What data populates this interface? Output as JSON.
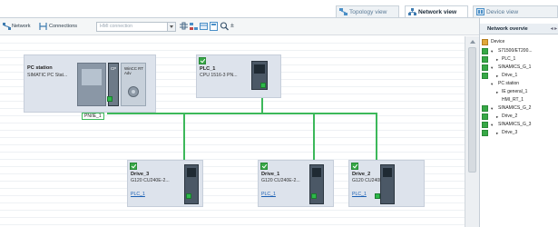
{
  "view_tabs": [
    {
      "label": "Topology view",
      "icon": "topology-icon",
      "active": false
    },
    {
      "label": "Network view",
      "icon": "network-icon",
      "active": true
    },
    {
      "label": "Device view",
      "icon": "device-icon",
      "active": false
    }
  ],
  "toolbar": {
    "network_label": "Network",
    "connections_label": "Connections",
    "connection_type_placeholder": "HMI connection"
  },
  "devices": {
    "pc_station": {
      "name": "PC station",
      "type": "SIMATIC PC Stat...",
      "module_labels": [
        "CP",
        "WinCC RT Adv"
      ]
    },
    "plc_1": {
      "name": "PLC_1",
      "type": "CPU 1516-3 PN..."
    },
    "drive_3": {
      "name": "Drive_3",
      "type": "G120 CU240E-2...",
      "link": "PLC_1"
    },
    "drive_1": {
      "name": "Drive_1",
      "type": "G120 CU240E-2...",
      "link": "PLC_1"
    },
    "drive_2": {
      "name": "Drive_2",
      "type": "G120 CU240E-2...",
      "link": "PLC_1"
    }
  },
  "port_label": "PN/IE_1",
  "network_overview": {
    "title": "Network overvie",
    "nav": "◂ ▸",
    "tree": [
      {
        "label": "Device",
        "level": 0,
        "icon": "device-icon"
      },
      {
        "label": "S71500/ET200...",
        "level": 1
      },
      {
        "label": "PLC_1",
        "level": 2
      },
      {
        "label": "SINAMICS_G_1",
        "level": 1
      },
      {
        "label": "Drive_1",
        "level": 2
      },
      {
        "label": "PC station",
        "level": 1
      },
      {
        "label": "IE general_1",
        "level": 2
      },
      {
        "label": "HMI_RT_1",
        "level": 2
      },
      {
        "label": "SINAMICS_G_2",
        "level": 1
      },
      {
        "label": "Drive_2",
        "level": 2
      },
      {
        "label": "SINAMICS_G_3",
        "level": 1
      },
      {
        "label": "Drive_3",
        "level": 2
      }
    ]
  },
  "colors": {
    "bus": "#3cb85a",
    "accent": "#37a846",
    "device_bg": "#dde3ec"
  }
}
